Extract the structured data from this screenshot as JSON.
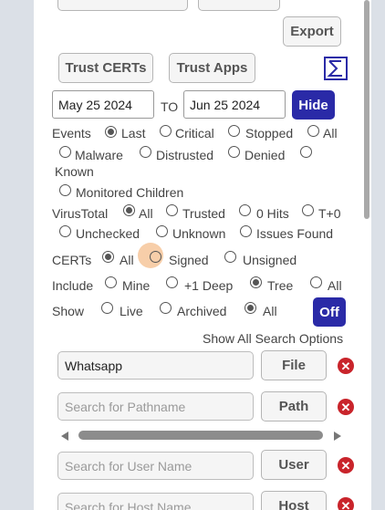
{
  "toolbar": {
    "export_label": "Export"
  },
  "trust": {
    "certs_label": "Trust CERTs",
    "apps_label": "Trust Apps",
    "sigma_icon": "sigma-icon"
  },
  "dates": {
    "from": "May 25 2024",
    "to_label": "TO",
    "to": "Jun 25 2024",
    "hide_label": "Hide"
  },
  "events": {
    "label": "Events",
    "options": [
      "Last",
      "Critical",
      "Stopped",
      "All",
      "Malware",
      "Distrusted",
      "Denied",
      "Known",
      "Monitored Children"
    ],
    "selected": "Last"
  },
  "virustotal": {
    "label": "VirusTotal",
    "options": [
      "All",
      "Trusted",
      "0 Hits",
      "T+0",
      "Unchecked",
      "Unknown",
      "Issues Found"
    ],
    "selected": "All"
  },
  "certs": {
    "label": "CERTs",
    "options": [
      "All",
      "Signed",
      "Unsigned"
    ],
    "selected": "All"
  },
  "include": {
    "label": "Include",
    "options": [
      "Mine",
      "+1 Deep",
      "Tree",
      "All"
    ],
    "selected": "Tree"
  },
  "show": {
    "label": "Show",
    "options": [
      "Live",
      "Archived",
      "All"
    ],
    "selected": "All",
    "toggle_label": "Off"
  },
  "search_options_link": "Show All Search Options",
  "searches": [
    {
      "value": "Whatsapp",
      "placeholder": "",
      "button": "File"
    },
    {
      "value": "",
      "placeholder": "Search for Pathname",
      "button": "Path"
    },
    {
      "value": "",
      "placeholder": "Search for User Name",
      "button": "User"
    },
    {
      "value": "",
      "placeholder": "Search for Host Name",
      "button": "Host"
    }
  ],
  "colors": {
    "accent": "#2a2aa7",
    "danger": "#c9242b",
    "highlight": "#f6c59a"
  }
}
